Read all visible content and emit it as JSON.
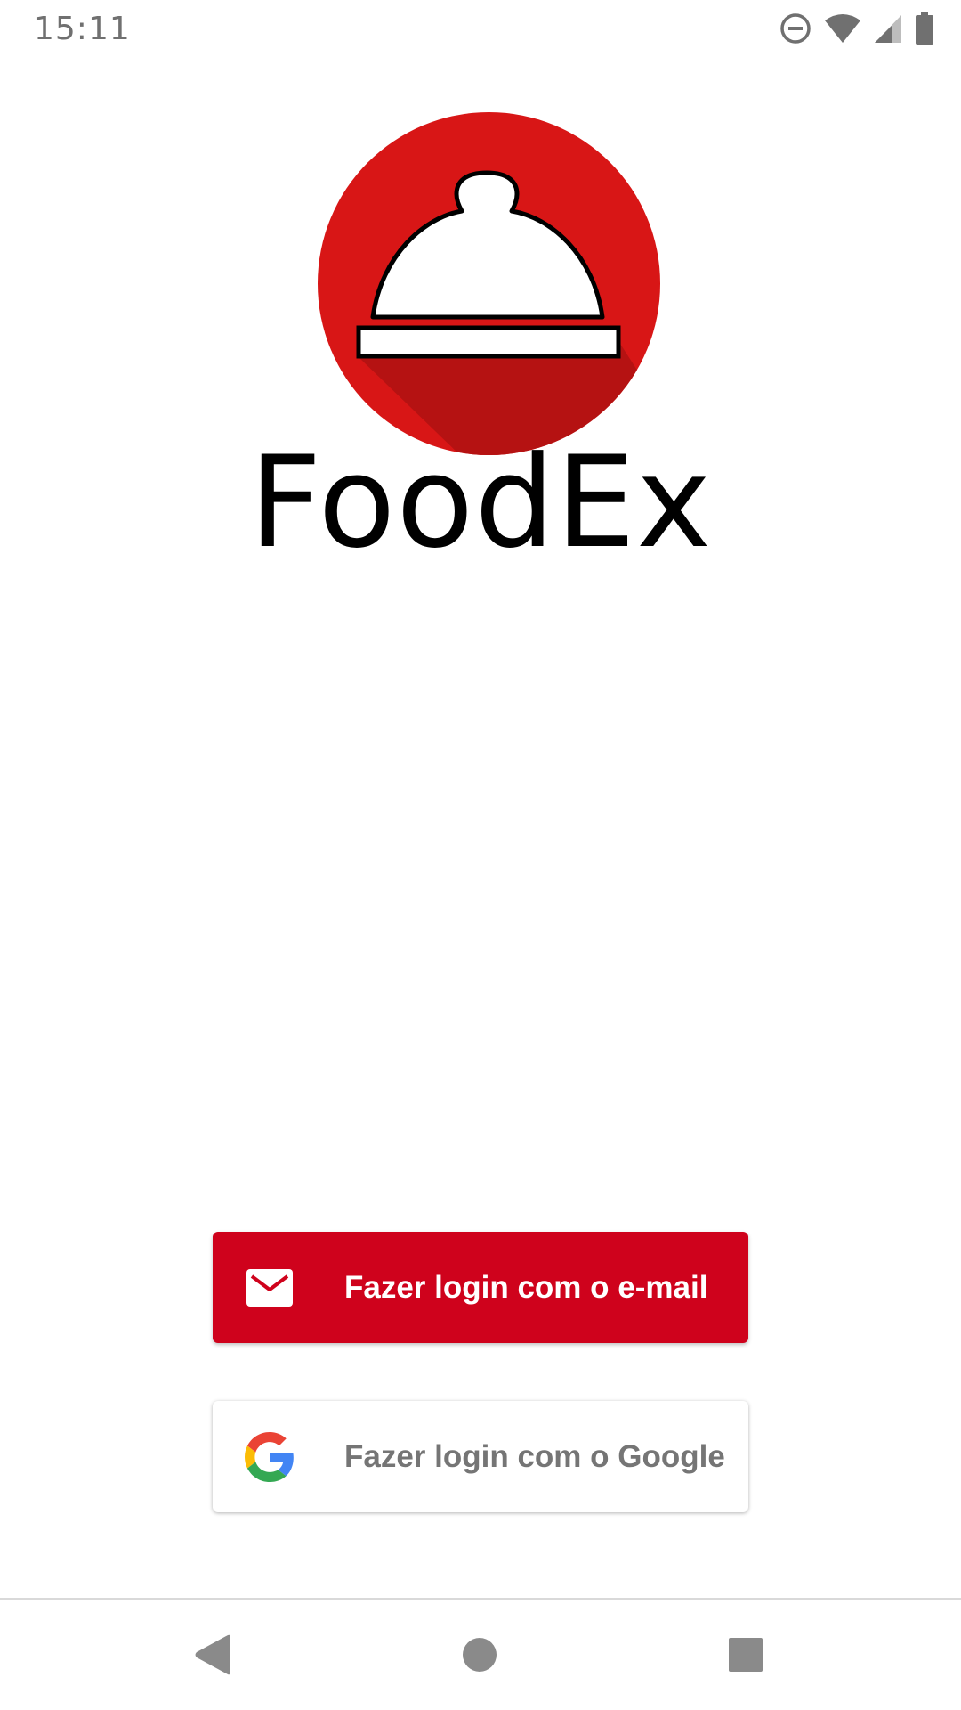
{
  "status_bar": {
    "time": "15:11",
    "icons": [
      "do-not-disturb-icon",
      "wifi-icon",
      "cell-signal-icon",
      "battery-icon"
    ]
  },
  "app": {
    "name": "FoodEx",
    "logo_icon": "food-cloche-icon"
  },
  "login": {
    "email_button_label": "Fazer login com o e-mail",
    "email_icon": "mail-icon",
    "google_button_label": "Fazer login com o Google",
    "google_icon": "google-icon"
  },
  "nav_bar": {
    "icons": [
      "back-icon",
      "home-icon",
      "recents-icon"
    ]
  },
  "colors": {
    "brand_red": "#d81616",
    "email_button": "#cf021c",
    "google_text": "#757575",
    "status_gray": "#707070"
  }
}
